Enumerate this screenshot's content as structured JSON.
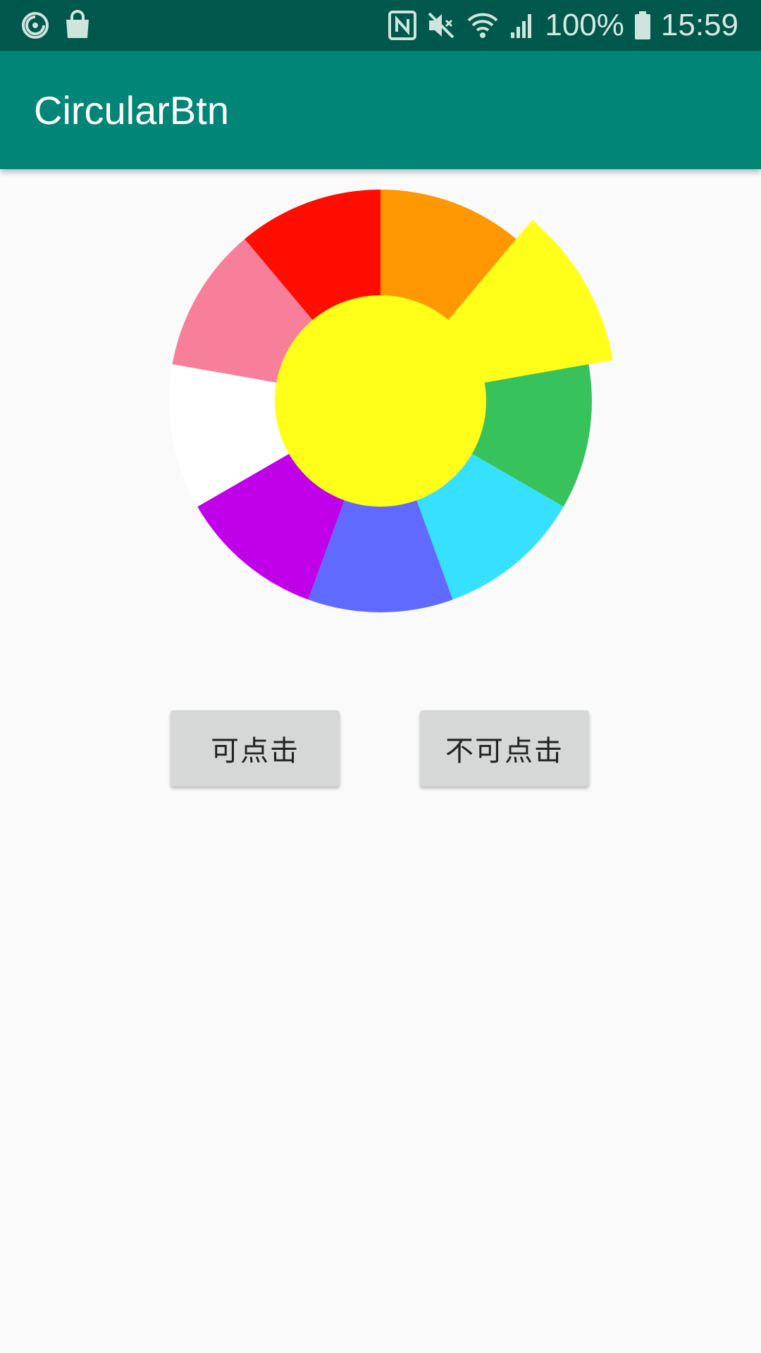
{
  "status_bar": {
    "battery_percent": "100%",
    "time": "15:59",
    "icons": [
      "sync-icon",
      "shopping-bag-icon",
      "nfc-icon",
      "mute-icon",
      "wifi-icon",
      "signal-icon",
      "battery-icon"
    ]
  },
  "app_bar": {
    "title": "CircularBtn"
  },
  "wheel": {
    "segments": [
      {
        "name": "orange",
        "color": "#ff9800"
      },
      {
        "name": "yellow",
        "color": "#ffff19",
        "selected": true
      },
      {
        "name": "green",
        "color": "#37c25c"
      },
      {
        "name": "cyan",
        "color": "#35e1fe"
      },
      {
        "name": "blue",
        "color": "#616aff"
      },
      {
        "name": "purple",
        "color": "#c000e8"
      },
      {
        "name": "white",
        "color": "#ffffff"
      },
      {
        "name": "pink",
        "color": "#f77f9a"
      },
      {
        "name": "red",
        "color": "#ff0d00"
      }
    ],
    "center_color": "#ffff19"
  },
  "buttons": {
    "clickable_label": "可点击",
    "not_clickable_label": "不可点击"
  }
}
